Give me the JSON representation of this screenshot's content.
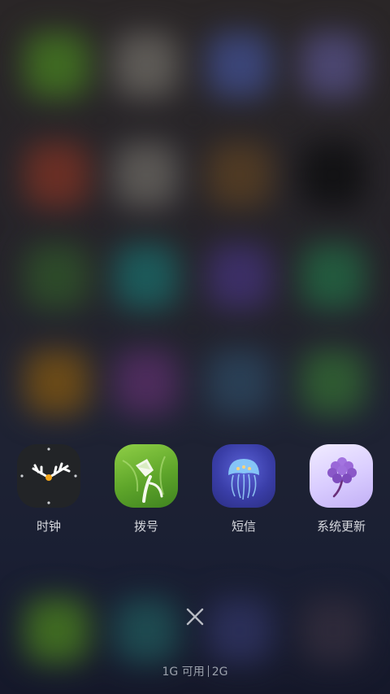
{
  "apps": [
    {
      "id": "clock",
      "label": "时钟",
      "icon": "clock-icon"
    },
    {
      "id": "dialer",
      "label": "拨号",
      "icon": "dialer-icon"
    },
    {
      "id": "messages",
      "label": "短信",
      "icon": "jellyfish-icon"
    },
    {
      "id": "update",
      "label": "系统更新",
      "icon": "flower-icon"
    }
  ],
  "memory": {
    "free": "1G 可用",
    "total": "2G"
  },
  "colors": {
    "label": "#d6d8de",
    "memory_text": "#9aa0ab",
    "close_icon": "#b9bcc4"
  }
}
